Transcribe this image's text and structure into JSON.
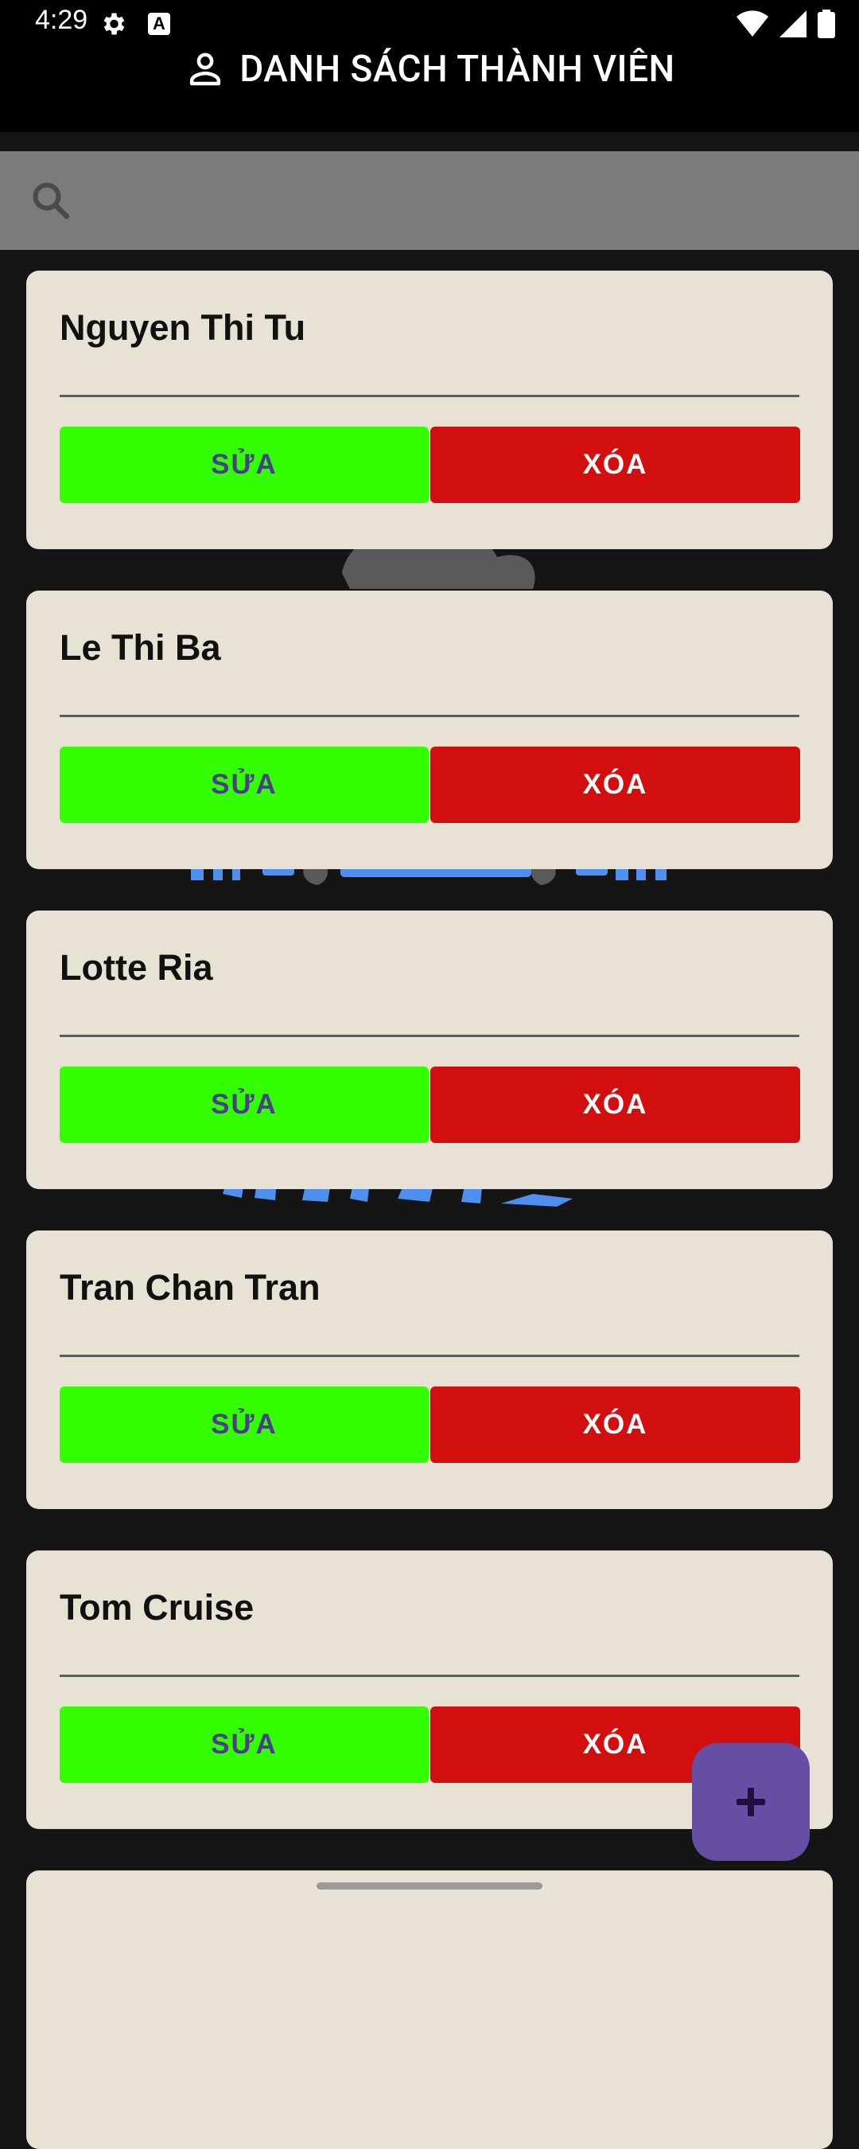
{
  "status_bar": {
    "time": "4:29"
  },
  "header": {
    "title": "DANH SÁCH THÀNH VIÊN"
  },
  "search": {
    "placeholder": ""
  },
  "members": [
    {
      "name": "Nguyen Thi Tu",
      "edit_label": "SỬA",
      "delete_label": "XÓA"
    },
    {
      "name": "Le Thi Ba",
      "edit_label": "SỬA",
      "delete_label": "XÓA"
    },
    {
      "name": "Lotte Ria",
      "edit_label": "SỬA",
      "delete_label": "XÓA"
    },
    {
      "name": "Tran Chan Tran",
      "edit_label": "SỬA",
      "delete_label": "XÓA"
    },
    {
      "name": "Tom Cruise",
      "edit_label": "SỬA",
      "delete_label": "XÓA"
    },
    {
      "name": "",
      "edit_label": "",
      "delete_label": ""
    }
  ],
  "colors": {
    "edit_button": "#33ff00",
    "delete_button": "#d20e0e",
    "card_background": "#e8e2d4",
    "fab": "#654ea3",
    "search_bar": "#7b7b7b"
  },
  "icons": {
    "header": "person-icon",
    "search": "search-icon",
    "fab": "plus-icon"
  }
}
